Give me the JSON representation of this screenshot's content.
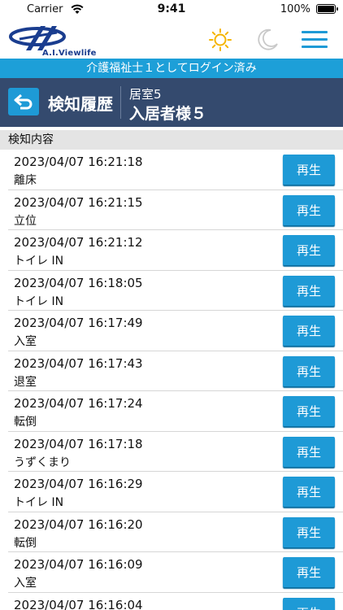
{
  "status_bar": {
    "carrier": "Carrier",
    "time": "9:41",
    "battery": "100%"
  },
  "app_header": {
    "logo_text": "A.I.Viewlife",
    "accent": "#1e9ad6"
  },
  "login_banner": "介護福祉士１としてログイン済み",
  "page_header": {
    "title": "検知履歴",
    "room": "居室5",
    "resident": "入居者様５"
  },
  "section_label": "検知内容",
  "play_label": "再生",
  "detections": [
    {
      "timestamp": "2023/04/07 16:21:18",
      "event": "離床"
    },
    {
      "timestamp": "2023/04/07 16:21:15",
      "event": "立位"
    },
    {
      "timestamp": "2023/04/07 16:21:12",
      "event": "トイレ IN"
    },
    {
      "timestamp": "2023/04/07 16:18:05",
      "event": "トイレ IN"
    },
    {
      "timestamp": "2023/04/07 16:17:49",
      "event": "入室"
    },
    {
      "timestamp": "2023/04/07 16:17:43",
      "event": "退室"
    },
    {
      "timestamp": "2023/04/07 16:17:24",
      "event": "転倒"
    },
    {
      "timestamp": "2023/04/07 16:17:18",
      "event": "うずくまり"
    },
    {
      "timestamp": "2023/04/07 16:16:29",
      "event": "トイレ IN"
    },
    {
      "timestamp": "2023/04/07 16:16:20",
      "event": "転倒"
    },
    {
      "timestamp": "2023/04/07 16:16:09",
      "event": "入室"
    },
    {
      "timestamp": "2023/04/07 16:16:04",
      "event": ""
    }
  ]
}
